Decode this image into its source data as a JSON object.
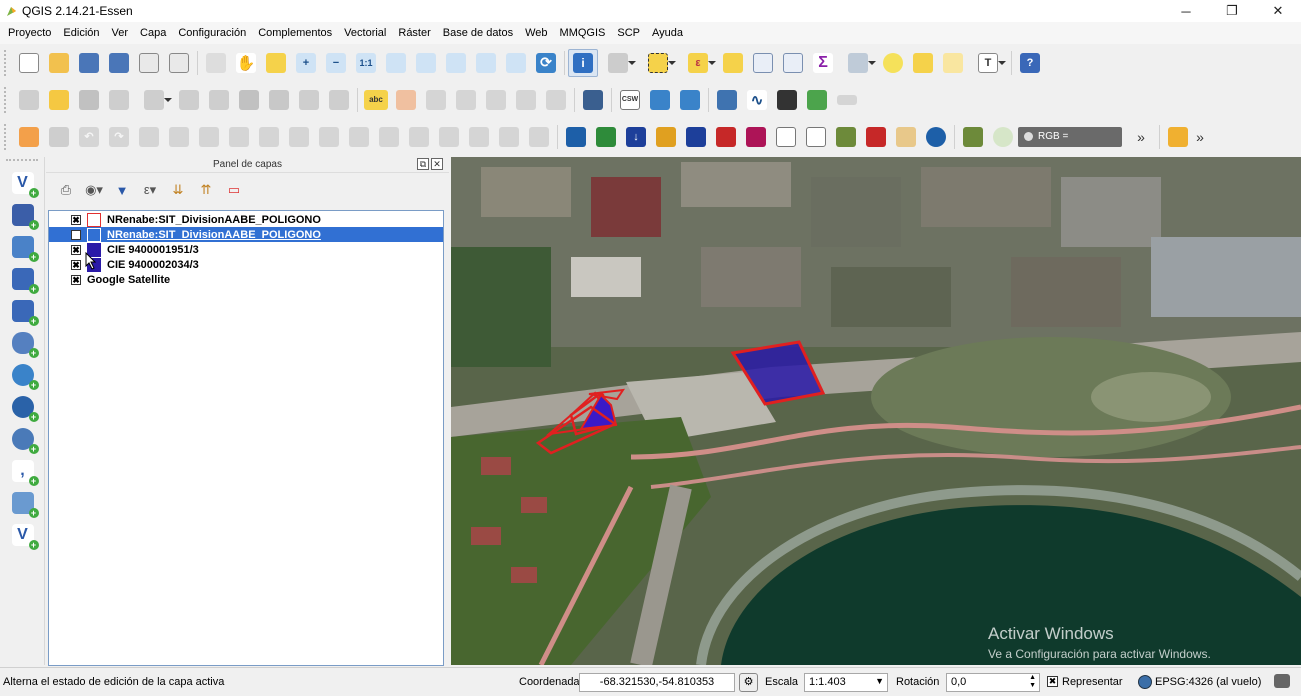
{
  "window": {
    "title": "QGIS 2.14.21-Essen",
    "minimize": "─",
    "maximize": "❐",
    "close": "✕"
  },
  "menu": [
    "Proyecto",
    "Edición",
    "Ver",
    "Capa",
    "Configuración",
    "Complementos",
    "Vectorial",
    "Ráster",
    "Base de datos",
    "Web",
    "MMQGIS",
    "SCP",
    "Ayuda"
  ],
  "toolbar_raster_label": "RGB =",
  "toolbar_overflow": "»",
  "layers_panel": {
    "title": "Panel de capas",
    "float_btn": "⧉",
    "close_btn": "✕",
    "layers": [
      {
        "name": "NRenabe:SIT_DivisionAABE_POLIGONO",
        "checked": "✖",
        "symbol_fill": "#ffffff",
        "symbol_stroke": "#e23030"
      },
      {
        "name": "NRenabe:SIT_DivisionAABE_POLIGONO",
        "checked": "✖",
        "symbol_fill": "#ffffff",
        "symbol_stroke": "#3170d3",
        "selected": true
      },
      {
        "name": "CIE 9400001951/3",
        "checked": "✖",
        "symbol_fill": "#2a1aa8",
        "symbol_stroke": "#2a1aa8"
      },
      {
        "name": "CIE 9400002034/3",
        "checked": "✖",
        "symbol_fill": "#2a1aa8",
        "symbol_stroke": "#2a1aa8"
      },
      {
        "name": "Google Satellite",
        "checked": "✖"
      }
    ]
  },
  "watermark": {
    "line1": "Activar Windows",
    "line2": "Ve a Configuración para activar Windows."
  },
  "statusbar": {
    "message": "Alterna el estado de edición de la capa activa",
    "coord_label": "Coordenada",
    "coord_value": "-68.321530,-54.810353",
    "scale_label": "Escala",
    "scale_value": "1:1.403",
    "rotation_label": "Rotación",
    "rotation_value": "0,0",
    "render_check": "✖",
    "render_label": "Representar",
    "crs_label": "EPSG:4326 (al vuelo)"
  },
  "colors": {
    "accent": "#3170d3",
    "polygon_outline": "#e02020",
    "polygon_fill": "#2a1aa8"
  }
}
